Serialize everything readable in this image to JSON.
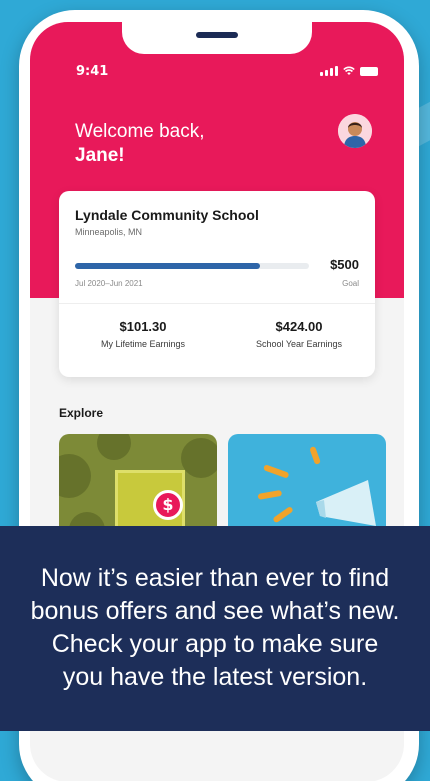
{
  "status_bar": {
    "time": "9:41"
  },
  "header": {
    "greeting": "Welcome back,",
    "name": "Jane!"
  },
  "school_card": {
    "school_name": "Lyndale Community School",
    "location": "Minneapolis, MN",
    "progress_fraction": 0.79,
    "goal_amount": "$500",
    "date_range": "Jul 2020–Jun 2021",
    "goal_label": "Goal",
    "lifetime_earnings_value": "$101.30",
    "lifetime_earnings_label": "My Lifetime Earnings",
    "school_year_earnings_value": "$424.00",
    "school_year_earnings_label": "School Year Earnings"
  },
  "explore": {
    "title": "Explore",
    "tiles": [
      {
        "icon": "dollar-badge-icon"
      },
      {
        "icon": "megaphone-icon"
      }
    ]
  },
  "banner": {
    "line1": "Now it’s easier than ever to find",
    "line2": "bonus offers and see what’s new.",
    "line3": "Check your app to make sure",
    "line4": "you have the latest version."
  },
  "colors": {
    "brand_red": "#e8195a",
    "navy": "#1d2e59",
    "background_blue": "#2fa9d6",
    "progress_blue": "#2e65a8"
  }
}
